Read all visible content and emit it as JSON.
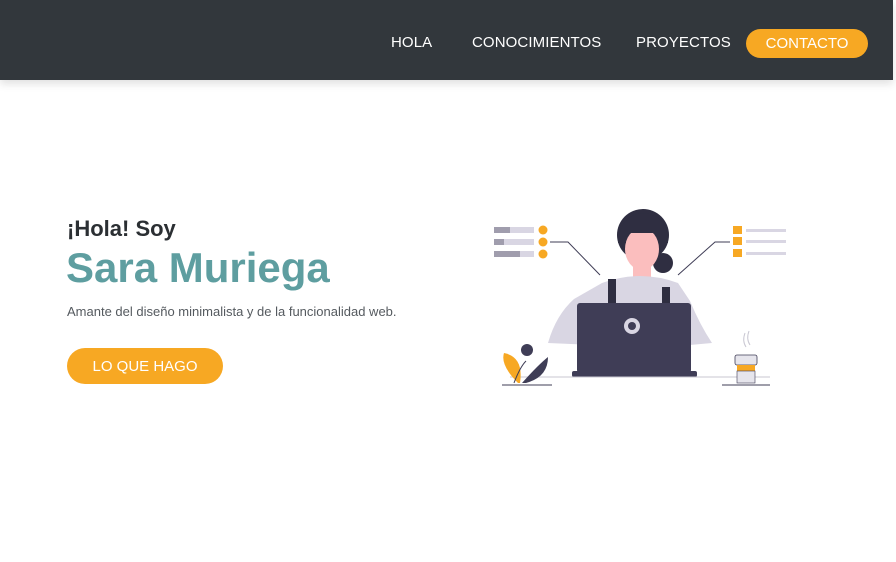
{
  "nav": {
    "items": [
      "HOLA",
      "CONOCIMIENTOS",
      "PROYECTOS"
    ],
    "contact_label": "CONTACTO"
  },
  "hero": {
    "greeting": "¡Hola! Soy",
    "name": "Sara Muriega",
    "tagline": "Amante del diseño minimalista y de la funcionalidad web.",
    "cta_label": "LO QUE HAGO"
  },
  "illustration": {
    "icon": "woman-at-laptop-illustration",
    "colors": {
      "accent": "#f7a823",
      "laptop": "#3f3d56",
      "shirt": "#d9d6e3",
      "skin": "#fbbebe",
      "hair": "#2f2e41"
    }
  },
  "colors": {
    "navbar_bg": "#32373c",
    "accent": "#f7a823",
    "name": "#5e9ea0",
    "text": "#2b2f33"
  }
}
